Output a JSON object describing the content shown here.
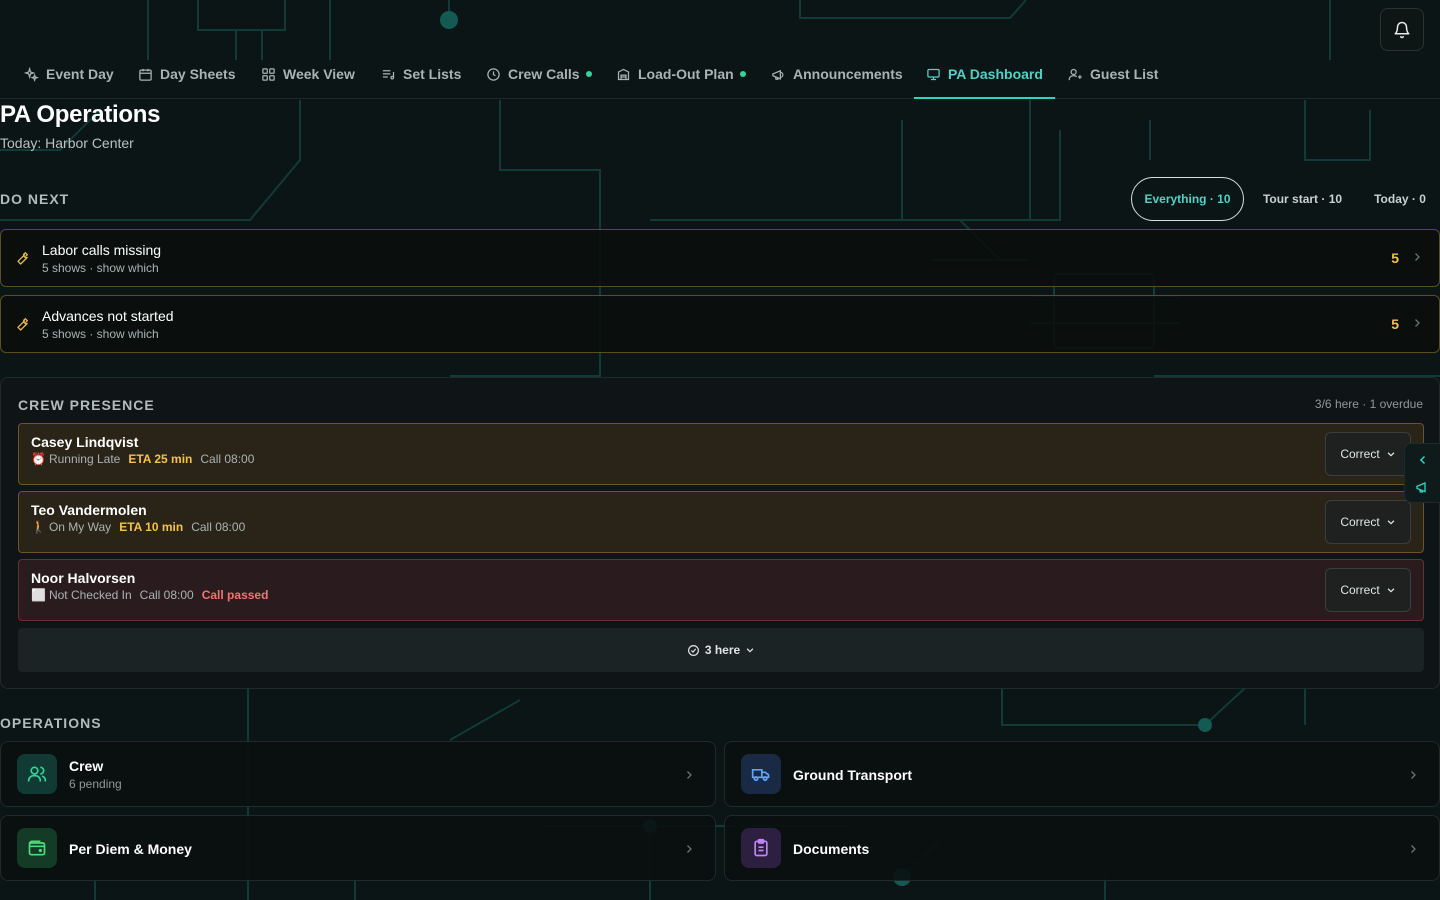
{
  "nav": {
    "tabs": [
      {
        "label": "Event Day",
        "icon": "sparkle-icon",
        "active": false,
        "dot": false
      },
      {
        "label": "Day Sheets",
        "icon": "calendar-icon",
        "active": false,
        "dot": false
      },
      {
        "label": "Week View",
        "icon": "grid-icon",
        "active": false,
        "dot": false
      },
      {
        "label": "Set Lists",
        "icon": "list-music-icon",
        "active": false,
        "dot": false
      },
      {
        "label": "Crew Calls",
        "icon": "clock-icon",
        "active": false,
        "dot": true
      },
      {
        "label": "Load-Out Plan",
        "icon": "truck-box-icon",
        "active": false,
        "dot": true
      },
      {
        "label": "Announcements",
        "icon": "megaphone-icon",
        "active": false,
        "dot": false
      },
      {
        "label": "PA Dashboard",
        "icon": "monitor-icon",
        "active": true,
        "dot": false
      },
      {
        "label": "Guest List",
        "icon": "user-plus-icon",
        "active": false,
        "dot": false
      }
    ],
    "accent_color": "#2dd4bf",
    "dot_color": "#34d399"
  },
  "header": {
    "title": "PA Operations",
    "subtitle": "Today: Harbor Center"
  },
  "do_next": {
    "label": "DO NEXT",
    "filters": [
      {
        "label": "Everything · 10",
        "active": true
      },
      {
        "label": "Tour start · 10",
        "active": false
      },
      {
        "label": "Today · 0",
        "active": false
      }
    ],
    "tasks": [
      {
        "title": "Labor calls missing",
        "detail": "5 shows · show which",
        "count": "5",
        "icon": "wrench-icon"
      },
      {
        "title": "Advances not started",
        "detail": "5 shows · show which",
        "count": "5",
        "icon": "wrench-icon"
      }
    ]
  },
  "crew_presence": {
    "label": "CREW PRESENCE",
    "summary": "3/6 here · 1 overdue",
    "rows": [
      {
        "name": "Casey Lindqvist",
        "status_icon": "⏰",
        "status": "Running Late",
        "eta": "ETA 25 min",
        "call": "Call 08:00",
        "alert": "",
        "action": "Correct",
        "tone": "late"
      },
      {
        "name": "Teo Vandermolen",
        "status_icon": "🚶",
        "status": "On My Way",
        "eta": "ETA 10 min",
        "call": "Call 08:00",
        "alert": "",
        "action": "Correct",
        "tone": "late"
      },
      {
        "name": "Noor Halvorsen",
        "status_icon": "⬜",
        "status": "Not Checked In",
        "eta": "",
        "call": "Call 08:00",
        "alert": "Call passed",
        "action": "Correct",
        "tone": "miss"
      }
    ],
    "here_toggle": "3 here"
  },
  "operations": {
    "label": "OPERATIONS",
    "cards": [
      {
        "title": "Crew",
        "subtitle": "6 pending",
        "icon": "users-icon",
        "tile_color": "#123a34"
      },
      {
        "title": "Ground Transport",
        "subtitle": "",
        "icon": "van-icon",
        "tile_color": "#1b2a44"
      },
      {
        "title": "Per Diem & Money",
        "subtitle": "",
        "icon": "wallet-icon",
        "tile_color": "#133b26"
      },
      {
        "title": "Documents",
        "subtitle": "",
        "icon": "clipboard-icon",
        "tile_color": "#2d1f3f"
      }
    ]
  }
}
